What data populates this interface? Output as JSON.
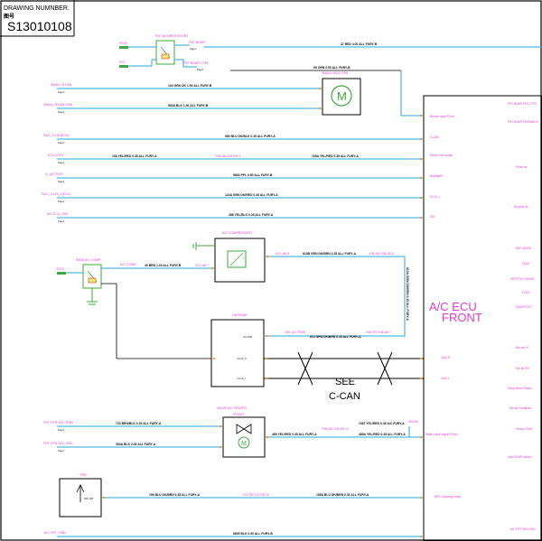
{
  "title_block": {
    "header": "DRAWING NUMNBER.",
    "sub": "图号",
    "number": "S13010108"
  },
  "components": {
    "blower_relay": "R07 BLOWER FRONT",
    "fuse_fe25": "FE25",
    "fuse_f02": "F02",
    "frt_blwr": "FRT BLWR",
    "frt_blwr_ctrl": "FRT BLWR CTRL",
    "small_rad_fan": "SMALL RAD. FAN",
    "ac_compressor": "A/C COMPRESSOR",
    "comp_relay": "RE08 A/C COMP",
    "fuse_fe11": "FE11",
    "ac_comp": "A/C COMP",
    "gateway": "GATEWAY",
    "valve_heater_1": "VALVE A/C HEATER",
    "valve_heater_2": "FRONT",
    "rrc": "RRC",
    "ecu_1": "A/C ECU",
    "ecu_2": "FRONT",
    "see_1": "SEE",
    "see_2": "C-CAN"
  },
  "wires": {
    "w_top": "37 RED 4.00 ALL FURY-B",
    "w_fan": "99 ORN 0.50 ALL FURY-B",
    "w_small": "104 GRN DK 1.50 ALL FURY-B",
    "w_small_gnd": "853A BLK 1.50 ALL FURY-B",
    "w_cl30": "580 BLU DK/BLK 0.35 ALL FURY-A",
    "w_ctrl_a": "108 YEL/RED 0.35 ALL FURY-A",
    "w_ctrl_b": "108A YEL/RED 0.35 ALL FURY-A",
    "w_pwr": "5803 PPL 0.50 ALL FURY-B",
    "w_cl15": "124A GRN DK/RED 0.35 ALL FURY-A",
    "w_ign": "486 YEL/BLK 0.35 ALL FURY-A",
    "w_comp": "40 BRN 1.00 ALL FURY-B",
    "w_comp2": "613B GRN DK/BRN 0.35 ALL FURY-A",
    "w_comp_v": "613A GRN DK/BRN 0.35 ALL FURY-A",
    "w_gw": "613 GRN DK/BRN 0.35 ALL FURY-A",
    "w_vlv1": "733 BRN/BLK 0.35 ALL FURY-A",
    "w_vlv2": "354A BLK 0.35 ALL FURY-A",
    "w_vlv3": "489 YEL/RED 0.35 ALL FURY-A",
    "w_vlv4": "489A YEL/RED 0.35 ALL FURY-A",
    "w_vlv5": "1087 YEL/RED 0.35 A/C FURY-A",
    "w_rrc1": "156 BLU DK/BRN 0.35 ALL FURY-A",
    "w_rrc2": "158A BLU DK/BRN 0.35 ALL FURY-A",
    "w_bottom": "8805 BLK 0.50 ALL FURY-B"
  },
  "left_labels": {
    "small_fan": "SMALL R.FAN",
    "small_fan_gnd": "SMALL R.FAN GND",
    "cl30": "FA/C_CL30(ECU)",
    "ctrl": "ECU CTRL",
    "pwr": "IL_A/C PWT",
    "cl15": "FA/C_CL15_1(ECU)",
    "ign": "A/C ECU_IGN",
    "vlv_a": "FRT HTR VLV_PWR",
    "vlv_b": "FRT HTR VLV_GND",
    "bottom": "A/C FRT_GND"
  },
  "ecu_pins": {
    "p1": "Blower relay+Front",
    "p2": "CL30a",
    "p3": "Electric fan signal",
    "p4": "Backlight+",
    "p5": "CL15_1",
    "p6": "IGN",
    "p7": "CAN-H",
    "p8": "CAN-L",
    "p9": "Water valve signal+Front",
    "p10": "RRC Learning motor"
  },
  "ecu_right": {
    "r1": "FRT BLWR SPD CTRL",
    "r2": "FRT BLWR FEEDBACK",
    "r3": "Fresh air",
    "r4": "Recycle air",
    "r5": "DEF MODE",
    "r6": "FACE",
    "r7": "DEF/FOOT MODE",
    "r8": "FOOT",
    "r9": "FACE/FOOT",
    "r10": "Mix air LE",
    "r11": "Mix air RE",
    "r12": "Temp Motor Power",
    "r13": "Mix air Feedback",
    "r14": "Sensor GND",
    "r15": "Input EVAP sensor",
    "r16": "A/C FRT SEN GND"
  },
  "connector_tags": {
    "c1": "Page3",
    "c2": "Page3",
    "c3": "Page3",
    "c4": "Page3",
    "c5": "Page3",
    "c6": "Page3",
    "c7": "Page3",
    "c8": "Page3",
    "c9": "Page3",
    "c10": "Page3",
    "c11": "Page3",
    "y1": "Y08-A6 X08-P6 3",
    "y2": "X07-A6 7",
    "y3": "X07-A6 8",
    "y4": "Y08-A5 Y08-A5 5",
    "y5": "SB_A/C PWR",
    "y6": "Y06-P5 Y08-A5 7",
    "y7": "Y08-A5 Y08-A5 14",
    "y8": "Y12-P8 Y12-P8 23",
    "y9": "SB033",
    "gw1": "A/C PWR",
    "gw2": "C-CAN_H",
    "gw3": "C-CAN_L",
    "rrc_dat": "RRC DAT"
  },
  "colors": {
    "wire_blue": "#2aa7d8",
    "label_magenta": "#e23ad0",
    "fuse_green": "#3ea83e",
    "relay_red": "#d23a3a"
  }
}
